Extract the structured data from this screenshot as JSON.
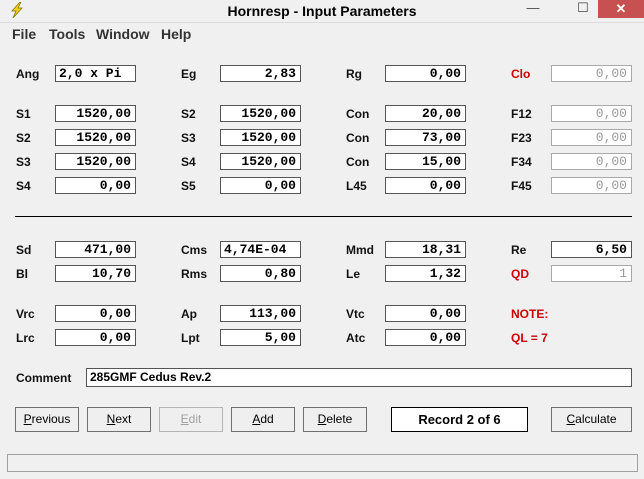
{
  "window": {
    "title": "Hornresp - Input Parameters",
    "close_glyph": "✕",
    "min_glyph": "—",
    "max_glyph": "☐"
  },
  "menu": [
    "File",
    "Tools",
    "Window",
    "Help"
  ],
  "rows": [
    [
      {
        "label": "Ang",
        "value": "2,0 x Pi",
        "align": "left"
      },
      {
        "label": "Eg",
        "value": "2,83"
      },
      {
        "label": "Rg",
        "value": "0,00"
      },
      {
        "label": "Clo",
        "value": "0,00",
        "red": true,
        "disabled": true
      }
    ],
    [
      {
        "label": "S1",
        "value": "1520,00"
      },
      {
        "label": "S2",
        "value": "1520,00"
      },
      {
        "label": "Con",
        "value": "20,00"
      },
      {
        "label": "F12",
        "value": "0,00",
        "disabled": true
      }
    ],
    [
      {
        "label": "S2",
        "value": "1520,00"
      },
      {
        "label": "S3",
        "value": "1520,00"
      },
      {
        "label": "Con",
        "value": "73,00"
      },
      {
        "label": "F23",
        "value": "0,00",
        "disabled": true
      }
    ],
    [
      {
        "label": "S3",
        "value": "1520,00"
      },
      {
        "label": "S4",
        "value": "1520,00"
      },
      {
        "label": "Con",
        "value": "15,00"
      },
      {
        "label": "F34",
        "value": "0,00",
        "disabled": true
      }
    ],
    [
      {
        "label": "S4",
        "value": "0,00"
      },
      {
        "label": "S5",
        "value": "0,00"
      },
      {
        "label": "L45",
        "value": "0,00"
      },
      {
        "label": "F45",
        "value": "0,00",
        "disabled": true
      }
    ],
    [
      {
        "label": "Sd",
        "value": "471,00"
      },
      {
        "label": "Cms",
        "value": "4,74E-04",
        "align": "left"
      },
      {
        "label": "Mmd",
        "value": "18,31"
      },
      {
        "label": "Re",
        "value": "6,50"
      }
    ],
    [
      {
        "label": "Bl",
        "value": "10,70"
      },
      {
        "label": "Rms",
        "value": "0,80"
      },
      {
        "label": "Le",
        "value": "1,32"
      },
      {
        "label": "QD",
        "value": "1",
        "red": true,
        "disabled": true
      }
    ],
    [
      {
        "label": "Vrc",
        "value": "0,00"
      },
      {
        "label": "Ap",
        "value": "113,00"
      },
      {
        "label": "Vtc",
        "value": "0,00"
      },
      {
        "label": "NOTE:",
        "red": true,
        "note": true
      }
    ],
    [
      {
        "label": "Lrc",
        "value": "0,00"
      },
      {
        "label": "Lpt",
        "value": "5,00"
      },
      {
        "label": "Atc",
        "value": "0,00"
      },
      {
        "label": "QL = 7",
        "red": true,
        "note": true
      }
    ]
  ],
  "comment": {
    "label": "Comment",
    "value": "285GMF Cedus Rev.2"
  },
  "buttons": [
    {
      "label": "Previous",
      "mnemonic": "P",
      "disabled": false
    },
    {
      "label": "Next",
      "mnemonic": "N",
      "disabled": false
    },
    {
      "label": "Edit",
      "mnemonic": "E",
      "disabled": true
    },
    {
      "label": "Add",
      "mnemonic": "A",
      "disabled": false
    },
    {
      "label": "Delete",
      "mnemonic": "D",
      "disabled": false
    }
  ],
  "record": "Record 2 of 6",
  "calculate": {
    "label": "Calculate",
    "mnemonic": "C"
  }
}
